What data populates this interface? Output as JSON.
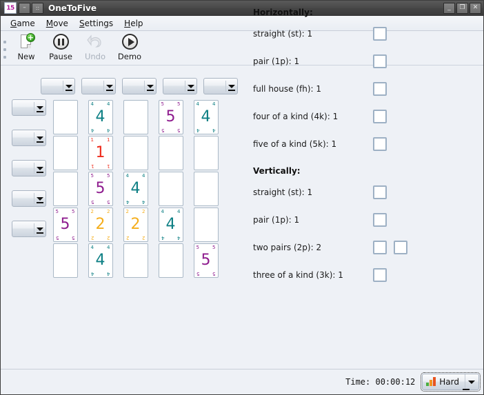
{
  "window": {
    "title": "OneToFive",
    "app_icon_label": "15",
    "buttons": {
      "shade_label": "–",
      "menu_label": "::",
      "minimize_label": "_",
      "maximize_label": "❐",
      "close_label": "✕"
    }
  },
  "menubar": {
    "items": [
      {
        "label": "Game",
        "mnemonic": "G"
      },
      {
        "label": "Move",
        "mnemonic": "M"
      },
      {
        "label": "Settings",
        "mnemonic": "S"
      },
      {
        "label": "Help",
        "mnemonic": "H"
      }
    ]
  },
  "toolbar": {
    "items": [
      {
        "label": "New",
        "icon": "new-document-icon",
        "enabled": true
      },
      {
        "label": "Pause",
        "icon": "pause-icon",
        "enabled": true
      },
      {
        "label": "Undo",
        "icon": "undo-icon",
        "enabled": false
      },
      {
        "label": "Demo",
        "icon": "play-icon",
        "enabled": true
      }
    ]
  },
  "board": {
    "column_selectors": [
      {
        "value": ""
      },
      {
        "value": ""
      },
      {
        "value": ""
      },
      {
        "value": ""
      },
      {
        "value": ""
      }
    ],
    "row_selectors": [
      {
        "value": ""
      },
      {
        "value": ""
      },
      {
        "value": ""
      },
      {
        "value": ""
      },
      {
        "value": ""
      }
    ],
    "card_colors": {
      "1": "#ee2b1c",
      "2": "#f5ae1c",
      "3": "#1f7ecc",
      "4": "#0d7f84",
      "5": "#8e1b8e"
    },
    "cards": [
      [
        null,
        "4",
        null,
        "5",
        "4"
      ],
      [
        null,
        "1",
        null,
        null,
        null
      ],
      [
        null,
        "5",
        "4",
        null,
        null
      ],
      [
        "5",
        "2",
        "2",
        "4",
        null
      ],
      [
        null,
        "4",
        null,
        null,
        "5"
      ]
    ]
  },
  "goals": {
    "horizontal": {
      "title": "Horizontally:",
      "rows": [
        {
          "label": "straight (st): 1",
          "boxes": 1
        },
        {
          "label": "pair (1p): 1",
          "boxes": 1
        },
        {
          "label": "full house (fh): 1",
          "boxes": 1
        },
        {
          "label": "four of a kind (4k): 1",
          "boxes": 1
        },
        {
          "label": "five of a kind (5k): 1",
          "boxes": 1
        }
      ]
    },
    "vertical": {
      "title": "Vertically:",
      "rows": [
        {
          "label": "straight (st): 1",
          "boxes": 1
        },
        {
          "label": "pair (1p): 1",
          "boxes": 1
        },
        {
          "label": "two pairs (2p): 2",
          "boxes": 2
        },
        {
          "label": "three of a kind (3k): 1",
          "boxes": 1
        }
      ]
    }
  },
  "statusbar": {
    "time_label": "Time:  00:00:12",
    "difficulty": "Hard",
    "difficulty_icon": "signal-bars-icon"
  }
}
